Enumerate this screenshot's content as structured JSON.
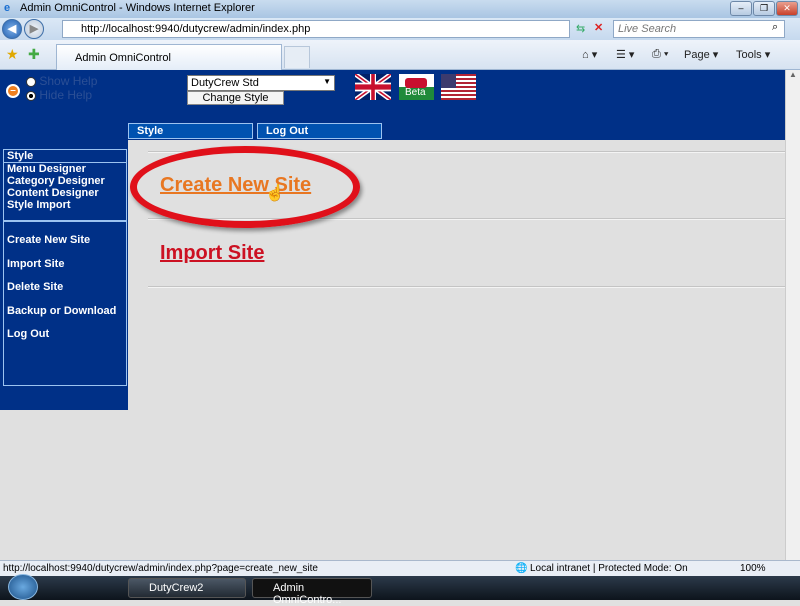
{
  "window": {
    "title": "Admin OmniControl - Windows Internet Explorer",
    "minimize": "–",
    "restore": "❐",
    "close": "✕"
  },
  "browser": {
    "url": "http://localhost:9940/dutycrew/admin/index.php",
    "search_placeholder": "Live Search",
    "tab_title": "Admin OmniControl",
    "tools": {
      "page": "Page ▾",
      "tools": "Tools ▾"
    }
  },
  "help": {
    "show": "Show Help",
    "hide": "Hide Help",
    "selected": "hide"
  },
  "style_select": {
    "value": "DutyCrew Std",
    "button": "Change Style"
  },
  "flags": [
    {
      "name": "uk-flag"
    },
    {
      "name": "wales-flag",
      "label": "Beta"
    },
    {
      "name": "us-flag"
    }
  ],
  "nav_tabs": [
    {
      "label": "Style"
    },
    {
      "label": "Log Out"
    }
  ],
  "sidebar": {
    "style_header": "Style",
    "style_items": [
      "Menu Designer",
      "Category Designer",
      "Content Designer",
      "Style Import"
    ],
    "links": [
      "Create New Site",
      "Import Site",
      "Delete Site",
      "Backup or Download",
      "Log Out"
    ]
  },
  "main": {
    "links": [
      {
        "label": "Create New Site",
        "color": "#e87722"
      },
      {
        "label": "Import Site",
        "color": "#cc1122"
      }
    ],
    "highlight_color": "#e0101a"
  },
  "status": {
    "url": "http://localhost:9940/dutycrew/admin/index.php?page=create_new_site",
    "zone": "Local intranet | Protected Mode: On",
    "zoom": "100%"
  },
  "taskbar": {
    "items": [
      "DutyCrew2",
      "Admin OmniContro..."
    ]
  }
}
